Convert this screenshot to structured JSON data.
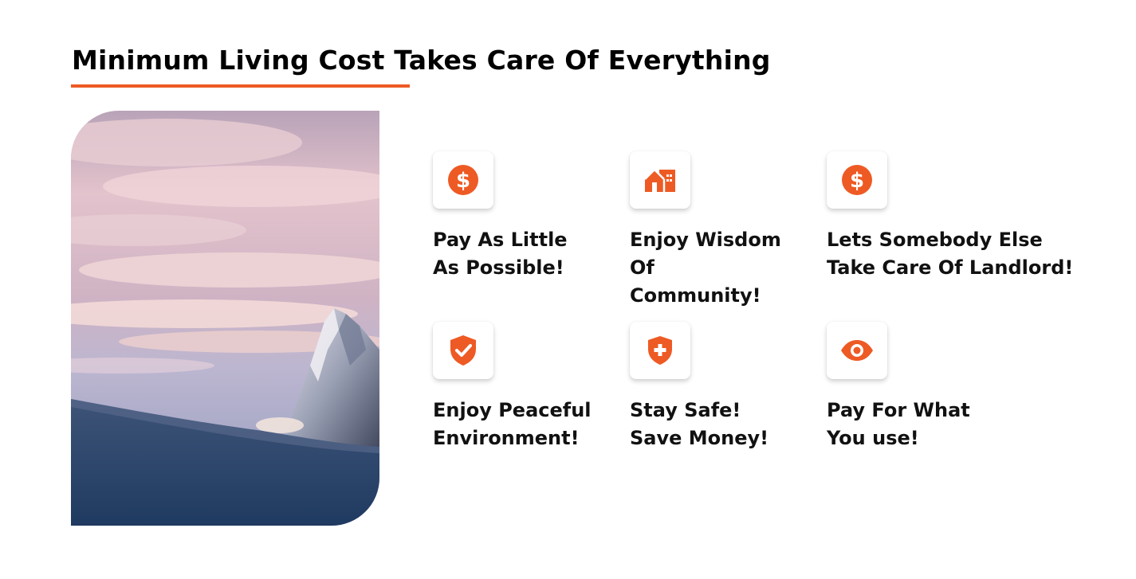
{
  "heading": "Minimum Living Cost Takes Care Of Everything",
  "colors": {
    "accent": "#ee5a24",
    "text": "#111111",
    "background": "#ffffff"
  },
  "photo": {
    "subject": "snowy-mountain-peak-at-dusk"
  },
  "features": [
    {
      "icon": "dollar-circle-icon",
      "lines": [
        "Pay As Little",
        "As Possible!"
      ]
    },
    {
      "icon": "house-icon",
      "lines": [
        "Enjoy Wisdom",
        "Of",
        "Community!"
      ]
    },
    {
      "icon": "dollar-circle-icon",
      "lines": [
        "Lets Somebody Else",
        "Take Care Of Landlord!"
      ]
    },
    {
      "icon": "shield-check-icon",
      "lines": [
        "Enjoy Peaceful",
        "Environment!"
      ]
    },
    {
      "icon": "shield-plus-icon",
      "lines": [
        "Stay Safe!",
        "Save Money!"
      ]
    },
    {
      "icon": "eye-icon",
      "lines": [
        "Pay For What",
        "You use!"
      ]
    }
  ]
}
